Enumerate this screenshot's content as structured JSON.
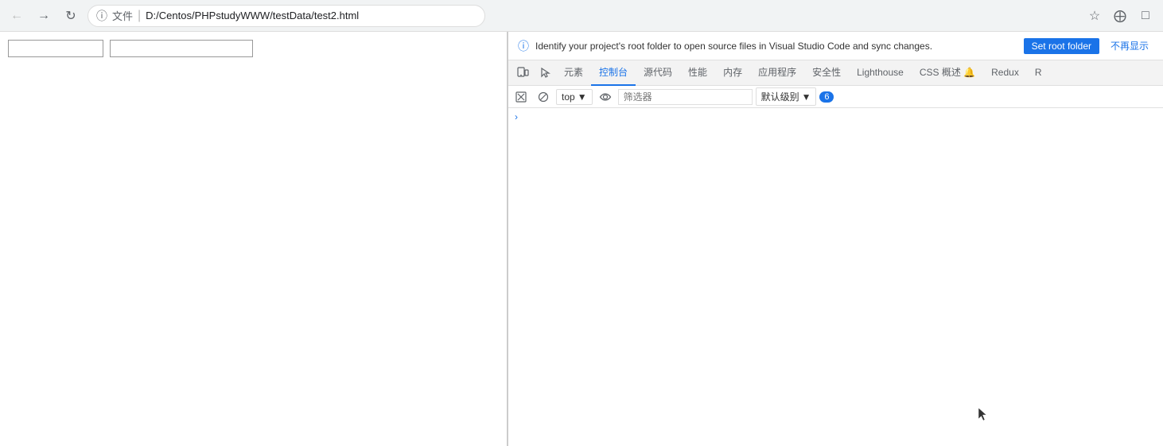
{
  "browser": {
    "back_btn": "←",
    "forward_btn": "→",
    "reload_btn": "↺",
    "file_label": "文件",
    "address": "D:/Centos/PHPstudyWWW/testData/test2.html",
    "separator": "|",
    "star_icon": "☆",
    "extension_icon": "⊕",
    "window_icon": "⬜"
  },
  "page": {
    "input1_placeholder": "",
    "input2_placeholder": ""
  },
  "devtools": {
    "info_banner": {
      "text": "Identify your project's root folder to open source files in Visual Studio Code and sync changes.",
      "set_root_label": "Set root folder",
      "dismiss_label": "不再显示"
    },
    "tabs": [
      {
        "id": "device",
        "label": "⬜",
        "is_icon": true
      },
      {
        "id": "inspect",
        "label": "⬜",
        "is_icon": true
      },
      {
        "id": "elements",
        "label": "元素"
      },
      {
        "id": "console",
        "label": "控制台"
      },
      {
        "id": "sources",
        "label": "源代码"
      },
      {
        "id": "performance",
        "label": "性能"
      },
      {
        "id": "memory",
        "label": "内存"
      },
      {
        "id": "application",
        "label": "应用程序"
      },
      {
        "id": "security",
        "label": "安全性"
      },
      {
        "id": "lighthouse",
        "label": "Lighthouse"
      },
      {
        "id": "css-overview",
        "label": "CSS 概述 🔔"
      },
      {
        "id": "redux",
        "label": "Redux"
      },
      {
        "id": "more",
        "label": "R"
      }
    ],
    "toolbar": {
      "clear_icon": "🚫",
      "block_icon": "⊘",
      "context_label": "top",
      "eye_icon": "👁",
      "filter_placeholder": "筛选器",
      "level_label": "默认级别",
      "badge_count": "6"
    },
    "console_content": {
      "arrow": "›"
    }
  }
}
